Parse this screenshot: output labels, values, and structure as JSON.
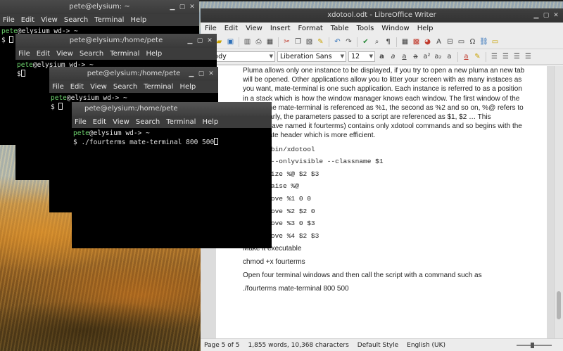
{
  "terminals": [
    {
      "title": "pete@elysium: ~",
      "menu": [
        "File",
        "Edit",
        "View",
        "Search",
        "Terminal",
        "Help"
      ],
      "prompt_user": "pete",
      "prompt_host": "@elysium",
      "prompt_dir": " wd-> ~",
      "prompt_symbol": "$",
      "command": ""
    },
    {
      "title": "pete@elysium:/home/pete",
      "menu": [
        "File",
        "Edit",
        "View",
        "Search",
        "Terminal",
        "Help"
      ],
      "prompt_user": "pete",
      "prompt_host": "@elysium",
      "prompt_dir": " wd-> ~",
      "prompt_symbol": "$",
      "command": ""
    },
    {
      "title": "pete@elysium:/home/pete",
      "menu": [
        "File",
        "Edit",
        "View",
        "Search",
        "Terminal",
        "Help"
      ],
      "prompt_user": "pete",
      "prompt_host": "@elysium",
      "prompt_dir": " wd-> ~",
      "prompt_symbol": "$",
      "command": ""
    },
    {
      "title": "pete@elysium:/home/pete",
      "menu": [
        "File",
        "Edit",
        "View",
        "Search",
        "Terminal",
        "Help"
      ],
      "prompt_user": "pete",
      "prompt_host": "@elysium",
      "prompt_dir": " wd-> ~",
      "prompt_symbol": "$",
      "command": " ./fourterms mate-terminal 800 500"
    }
  ],
  "writer": {
    "title": "xdotool.odt - LibreOffice Writer",
    "menu": [
      "File",
      "Edit",
      "View",
      "Insert",
      "Format",
      "Table",
      "Tools",
      "Window",
      "Help"
    ],
    "paragraph_style": "t Body",
    "font_name": "Liberation Sans",
    "font_size": "12",
    "para1": [
      "Pluma allows only one instance to be displayed, if you try to open a new pluma an new tab",
      "will be opened. Other applications allow you to litter your screen with as many instaces as",
      "you want, mate-terminal is one such application. Each instance is referred to as a position",
      "in a stack which is how the window manager knows each window. The first window of the",
      "classname mate-terminal is referenced as %1, the second as %2 and so on, %@ refers to",
      "all. Similarly, the parameters passed to a script are referenced as $1, $2 … This",
      "script (I have named it fourterms) contains only xdotool commands and so begins with the",
      "appropriate header which is more efficient."
    ],
    "code": [
      "#!/usr/bin/xdotool",
      "search --onlyvisible --classname $1",
      "windowsize %@ $2 $3",
      "windowraise %@",
      "windowmove %1 0 0",
      "windowmove %2 $2 0",
      "windowmove %3 0 $3",
      "windowmove %4 $2 $3"
    ],
    "body": [
      "Make it executable",
      "chmod +x fourterms",
      "Open four terminal windows and then call the script with a command such as",
      "./fourterms mate-terminal 800 500"
    ],
    "status": {
      "page": "Page 5 of 5",
      "words": "1,855 words, 10,368 characters",
      "style": "Default Style",
      "language": "English (UK)"
    }
  }
}
